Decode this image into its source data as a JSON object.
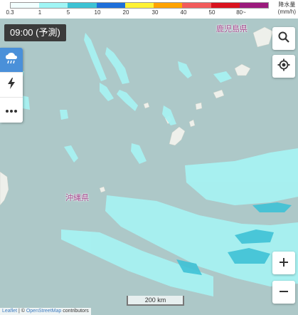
{
  "legend": {
    "ticks": [
      "0.3",
      "1",
      "5",
      "10",
      "20",
      "30",
      "40",
      "50",
      "80~"
    ],
    "colors": [
      "#f2ffff",
      "#a0f5f5",
      "#3dc2d4",
      "#1e6fd9",
      "#fff235",
      "#ffa300",
      "#f25b5b",
      "#d9121e",
      "#9b1a7c"
    ],
    "unit_line1": "降水量",
    "unit_line2": "(mm/h)"
  },
  "time_label": "09:00 (予測)",
  "labels": {
    "kagoshima": "鹿児島県",
    "okinawa": "沖縄県"
  },
  "scale": "200 km",
  "attribution": {
    "leaflet": "Leaflet",
    "separator": " | © ",
    "osm": "OpenStreetMap",
    "suffix": " contributors"
  },
  "icons": {
    "rain_tool": "cloud-rain-icon",
    "lightning_tool": "lightning-icon",
    "more_tool": "more-dots-icon",
    "search": "search-icon",
    "locate": "locate-icon"
  },
  "colors": {
    "sea": "#adc8c8",
    "land": "#eef0eb",
    "light_rain": "#a7f2f2",
    "medium_rain": "#3fc2d6"
  }
}
